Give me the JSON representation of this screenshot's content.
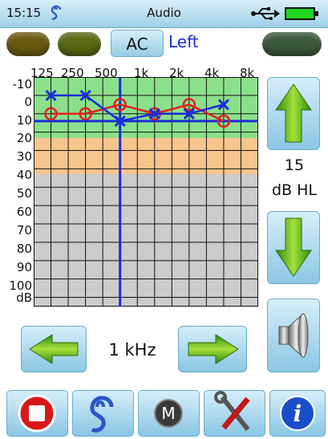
{
  "status": {
    "time": "15:15",
    "title": "Audio",
    "ear_icon": "ear-icon",
    "usb_icon": "usb-icon",
    "battery_icon": "battery-icon"
  },
  "top": {
    "mode_button": "AC",
    "ear_side": "Left"
  },
  "audiogram": {
    "freq_labels": [
      "125",
      "250",
      "500",
      "1k",
      "2k",
      "4k",
      "8k"
    ],
    "db_labels": [
      "-10",
      "0",
      "10",
      "20",
      "30",
      "40",
      "50",
      "60",
      "70",
      "80",
      "90",
      "100"
    ],
    "db_unit": "dB",
    "zone_colors": {
      "normal": "#8ce08c",
      "mild": "#f7c58e",
      "severe": "#cccccc"
    },
    "threshold_line_db": 14,
    "selected_frequency_index": 3,
    "series_blue_x": {
      "color": "#1a2cd8",
      "values": [
        0,
        0,
        14,
        10,
        10,
        5
      ]
    },
    "series_red_o": {
      "color": "#e02020",
      "values": [
        10,
        10,
        5,
        10,
        5,
        14
      ]
    }
  },
  "controls": {
    "hl_value": "15",
    "hl_unit": "dB HL",
    "frequency_value": "1 kHz",
    "up_icon": "arrow-up-icon",
    "down_icon": "arrow-down-icon",
    "left_icon": "arrow-left-icon",
    "right_icon": "arrow-right-icon",
    "speaker_icon": "speaker-icon"
  },
  "toolbar": {
    "stop_icon": "stop-icon",
    "ear_icon": "ear-icon",
    "m_icon": "m-icon",
    "m_label": "M",
    "tools_icon": "tools-icon",
    "info_icon": "info-icon",
    "info_label": "i"
  }
}
